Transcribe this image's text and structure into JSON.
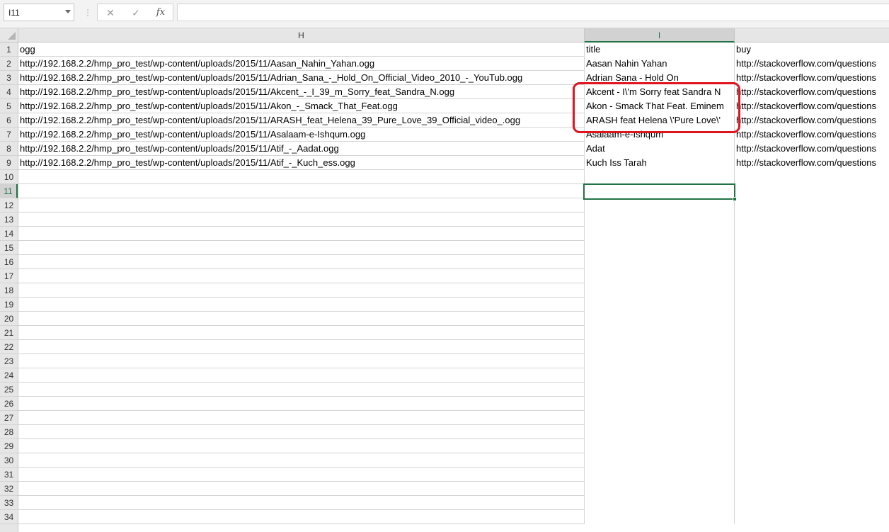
{
  "formula_bar": {
    "name_box": "I11",
    "separator": "⋮",
    "cancel_icon": "✕",
    "enter_icon": "✓",
    "fx_label": "fx",
    "formula": ""
  },
  "columns": [
    {
      "letter": "H"
    },
    {
      "letter": "I"
    },
    {
      "letter": ""
    }
  ],
  "rows": [
    {
      "num": "1",
      "h": "ogg",
      "i": "title",
      "j": "buy"
    },
    {
      "num": "2",
      "h": "http://192.168.2.2/hmp_pro_test/wp-content/uploads/2015/11/Aasan_Nahin_Yahan.ogg",
      "i": "Aasan Nahin Yahan",
      "j": "http://stackoverflow.com/questions"
    },
    {
      "num": "3",
      "h": "http://192.168.2.2/hmp_pro_test/wp-content/uploads/2015/11/Adrian_Sana_-_Hold_On_Official_Video_2010_-_YouTub.ogg",
      "i": "Adrian Sana - Hold On",
      "j": "http://stackoverflow.com/questions"
    },
    {
      "num": "4",
      "h": "http://192.168.2.2/hmp_pro_test/wp-content/uploads/2015/11/Akcent_-_I_39_m_Sorry_feat_Sandra_N.ogg",
      "i": "Akcent - I\\'m Sorry feat Sandra N",
      "j": "http://stackoverflow.com/questions"
    },
    {
      "num": "5",
      "h": "http://192.168.2.2/hmp_pro_test/wp-content/uploads/2015/11/Akon_-_Smack_That_Feat.ogg",
      "i": "Akon - Smack That Feat. Eminem",
      "j": "http://stackoverflow.com/questions"
    },
    {
      "num": "6",
      "h": "http://192.168.2.2/hmp_pro_test/wp-content/uploads/2015/11/ARASH_feat_Helena_39_Pure_Love_39_Official_video_.ogg",
      "i": "ARASH feat Helena \\'Pure Love\\'",
      "j": "http://stackoverflow.com/questions"
    },
    {
      "num": "7",
      "h": "http://192.168.2.2/hmp_pro_test/wp-content/uploads/2015/11/Asalaam-e-Ishqum.ogg",
      "i": "Asalaam-e-Ishqum",
      "j": "http://stackoverflow.com/questions"
    },
    {
      "num": "8",
      "h": "http://192.168.2.2/hmp_pro_test/wp-content/uploads/2015/11/Atif_-_Aadat.ogg",
      "i": "Adat",
      "j": "http://stackoverflow.com/questions"
    },
    {
      "num": "9",
      "h": "http://192.168.2.2/hmp_pro_test/wp-content/uploads/2015/11/Atif_-_Kuch_ess.ogg",
      "i": "Kuch Iss Tarah",
      "j": "http://stackoverflow.com/questions"
    },
    {
      "num": "10",
      "h": "",
      "i": "",
      "j": ""
    },
    {
      "num": "11",
      "h": "",
      "i": "",
      "j": ""
    },
    {
      "num": "12",
      "h": "",
      "i": "",
      "j": ""
    },
    {
      "num": "13",
      "h": "",
      "i": "",
      "j": ""
    },
    {
      "num": "14",
      "h": "",
      "i": "",
      "j": ""
    },
    {
      "num": "15",
      "h": "",
      "i": "",
      "j": ""
    },
    {
      "num": "16",
      "h": "",
      "i": "",
      "j": ""
    },
    {
      "num": "17",
      "h": "",
      "i": "",
      "j": ""
    },
    {
      "num": "18",
      "h": "",
      "i": "",
      "j": ""
    },
    {
      "num": "19",
      "h": "",
      "i": "",
      "j": ""
    },
    {
      "num": "20",
      "h": "",
      "i": "",
      "j": ""
    },
    {
      "num": "21",
      "h": "",
      "i": "",
      "j": ""
    },
    {
      "num": "22",
      "h": "",
      "i": "",
      "j": ""
    },
    {
      "num": "23",
      "h": "",
      "i": "",
      "j": ""
    },
    {
      "num": "24",
      "h": "",
      "i": "",
      "j": ""
    },
    {
      "num": "25",
      "h": "",
      "i": "",
      "j": ""
    },
    {
      "num": "26",
      "h": "",
      "i": "",
      "j": ""
    },
    {
      "num": "27",
      "h": "",
      "i": "",
      "j": ""
    },
    {
      "num": "28",
      "h": "",
      "i": "",
      "j": ""
    },
    {
      "num": "29",
      "h": "",
      "i": "",
      "j": ""
    },
    {
      "num": "30",
      "h": "",
      "i": "",
      "j": ""
    },
    {
      "num": "31",
      "h": "",
      "i": "",
      "j": ""
    },
    {
      "num": "32",
      "h": "",
      "i": "",
      "j": ""
    },
    {
      "num": "33",
      "h": "",
      "i": "",
      "j": ""
    },
    {
      "num": "34",
      "h": "",
      "i": "",
      "j": ""
    }
  ],
  "active_row": "11",
  "colors": {
    "selection": "#217346",
    "annotation": "#e0141e"
  }
}
